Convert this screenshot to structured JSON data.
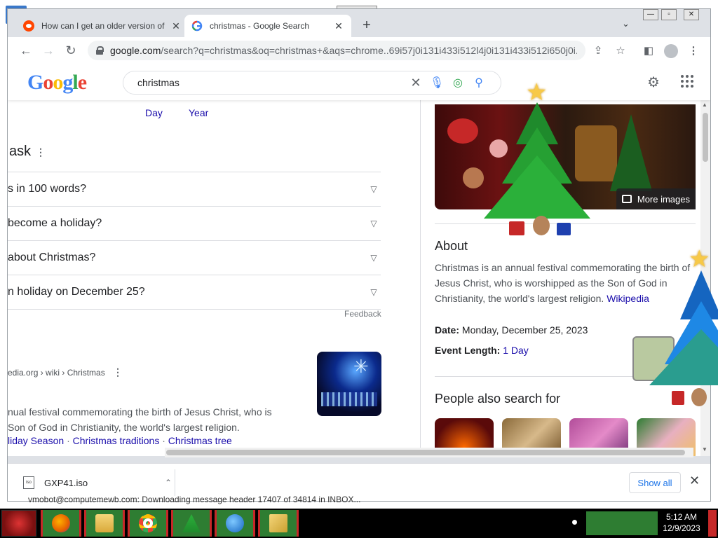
{
  "browser": {
    "tabs": [
      {
        "title": "How can I get an older version of",
        "active": false
      },
      {
        "title": "christmas - Google Search",
        "active": true
      }
    ],
    "url_host": "google.com",
    "url_rest": "/search?q=christmas&oq=christmas+&aqs=chrome..69i57j0i131i433i512l4j0i131i433i512i650j0i..."
  },
  "search": {
    "query": "christmas"
  },
  "left": {
    "date_filters": [
      "Day",
      "Year"
    ],
    "paa_title": "ask",
    "paa_questions": [
      "s in 100 words?",
      "become a holiday?",
      "about Christmas?",
      "n holiday on December 25?"
    ],
    "feedback": "Feedback",
    "result": {
      "cite": "edia.org › wiki › Christmas",
      "snippet_line1": "nual festival commemorating the birth of Jesus Christ, who is",
      "snippet_line2": "Son of God in Christianity, the world's largest religion.",
      "links": [
        "liday Season",
        "Christmas traditions",
        "Christmas tree"
      ]
    }
  },
  "knowledge_panel": {
    "more_images": "More images",
    "about_heading": "About",
    "about_text": "Christmas is an annual festival commemorating the birth of Jesus Christ, who is worshipped as the Son of God in Christianity, the world's largest religion.",
    "about_source": "Wikipedia",
    "date_label": "Date:",
    "date_value": "Monday, December 25, 2023",
    "length_label": "Event Length:",
    "length_value": "1 Day",
    "people_also_search": "People also search for"
  },
  "downloads": {
    "file_name": "GXP41.iso",
    "file_icon_text": "iso",
    "show_all": "Show all"
  },
  "status_strip": "vmobot@computemewb.com: Downloading message header 17407 of 34814 in INBOX...",
  "taskbar": {
    "time": "5:12 AM",
    "date": "12/9/2023"
  },
  "colors": {
    "link": "#1a0dab",
    "google_blue": "#4285f4",
    "taskbar_green": "#2e7d32",
    "taskbar_red": "#c62828"
  }
}
